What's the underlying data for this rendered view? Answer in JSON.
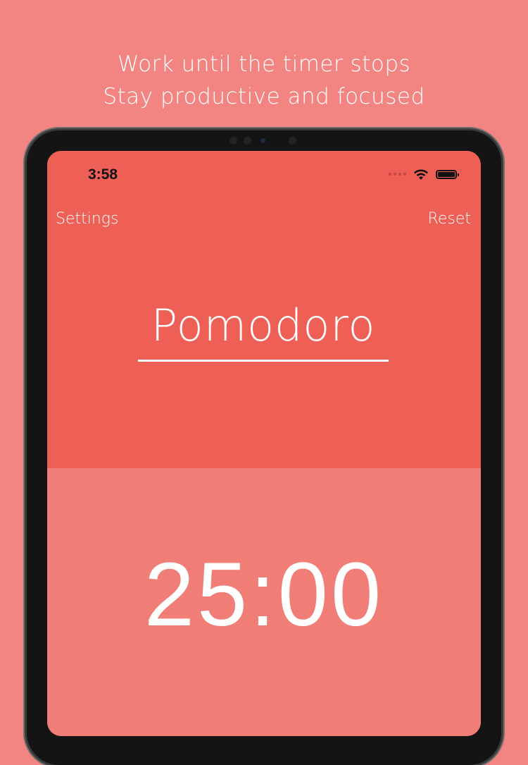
{
  "promo": {
    "line1": "Work until the timer stops",
    "line2": "Stay productive and focused"
  },
  "status_bar": {
    "time": "3:58",
    "icons": [
      "signal-dots-icon",
      "wifi-icon",
      "battery-icon"
    ]
  },
  "nav": {
    "settings_label": "Settings",
    "reset_label": "Reset"
  },
  "mode": {
    "title": "Pomodoro"
  },
  "timer": {
    "display": "25:00"
  },
  "colors": {
    "background": "#f28482",
    "top_panel": "#ee6055",
    "bottom_panel": "#f07e76",
    "text": "#ffffff"
  }
}
